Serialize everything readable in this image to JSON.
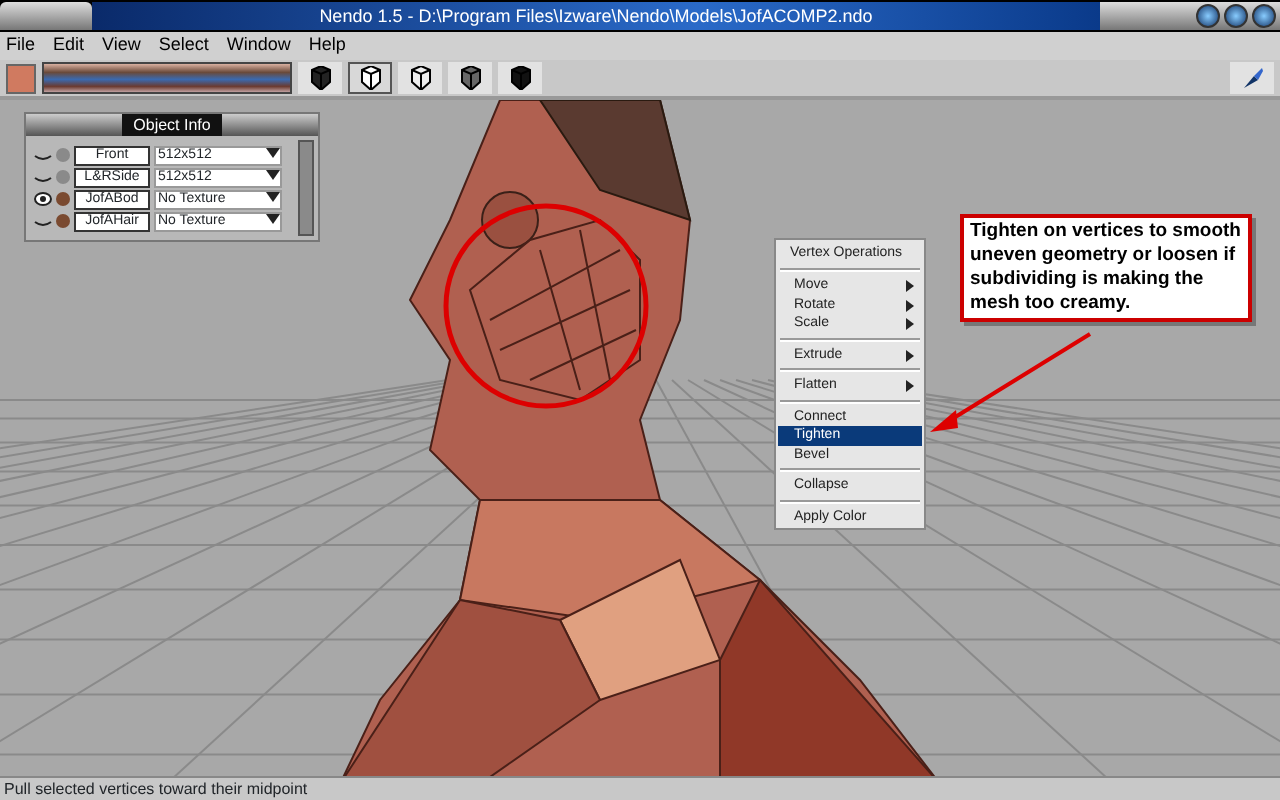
{
  "window": {
    "title": "Nendo 1.5 - D:\\Program Files\\Izware\\Nendo\\Models\\JofACOMP2.ndo"
  },
  "menu": [
    "File",
    "Edit",
    "View",
    "Select",
    "Window",
    "Help"
  ],
  "toolbar": {
    "color": "#d07a60",
    "shading_modes": [
      {
        "selected": false
      },
      {
        "selected": true
      },
      {
        "selected": false
      },
      {
        "selected": false
      },
      {
        "selected": false
      }
    ]
  },
  "object_info": {
    "title": "Object Info",
    "rows": [
      {
        "visible": false,
        "color": "#8a8a8a",
        "name": "Front",
        "texture": "512x512"
      },
      {
        "visible": false,
        "color": "#8a8a8a",
        "name": "L&RSide",
        "texture": "512x512"
      },
      {
        "visible": true,
        "color": "#7a4a30",
        "name": "JofABod",
        "texture": "No Texture"
      },
      {
        "visible": false,
        "color": "#7a4a30",
        "name": "JofAHair",
        "texture": "No Texture"
      }
    ]
  },
  "context_menu": [
    {
      "kind": "title",
      "label": "Vertex Operations"
    },
    {
      "kind": "separator"
    },
    {
      "kind": "submenu",
      "label": "Move",
      "selected": false
    },
    {
      "kind": "submenu",
      "label": "Rotate",
      "selected": false
    },
    {
      "kind": "submenu",
      "label": "Scale",
      "selected": false
    },
    {
      "kind": "separator"
    },
    {
      "kind": "submenu",
      "label": "Extrude",
      "selected": false
    },
    {
      "kind": "separator"
    },
    {
      "kind": "submenu",
      "label": "Flatten",
      "selected": false
    },
    {
      "kind": "separator"
    },
    {
      "kind": "command",
      "label": "Connect",
      "selected": false
    },
    {
      "kind": "command",
      "label": "Tighten",
      "selected": true
    },
    {
      "kind": "command",
      "label": "Bevel",
      "selected": false
    },
    {
      "kind": "separator"
    },
    {
      "kind": "command",
      "label": "Collapse",
      "selected": false
    },
    {
      "kind": "separator"
    },
    {
      "kind": "command",
      "label": "Apply Color",
      "selected": false
    }
  ],
  "callout": "Tighten on vertices to smooth uneven geometry or loosen if subdividing is making the mesh too creamy.",
  "status_bar": "Pull selected vertices toward their midpoint"
}
